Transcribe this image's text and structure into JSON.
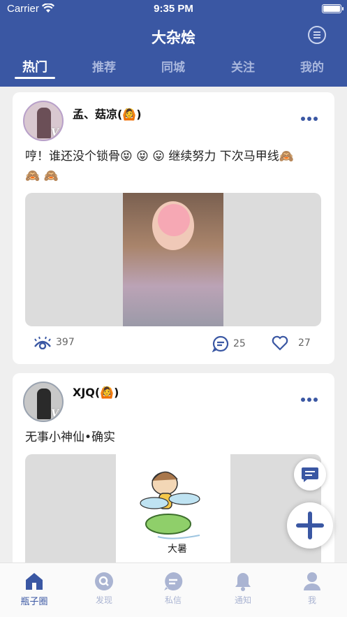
{
  "status": {
    "carrier": "Carrier",
    "time": "9:35 PM"
  },
  "header": {
    "title": "大杂烩"
  },
  "tabs": [
    "热门",
    "推荐",
    "同城",
    "关注",
    "我的"
  ],
  "posts": [
    {
      "name": "孟、菇凉(🙆)",
      "text_line1": "哼！谁还没个锁骨😝 😝 😛   继续努力 下次马甲线🙈",
      "text_line2": "🙈 🙈",
      "views": "397",
      "comments": "25",
      "likes": "27"
    },
    {
      "name": "XJQ(🙆)",
      "text_line1": "无事小神仙•确实"
    }
  ],
  "bottom_nav": [
    "瓶子圈",
    "发现",
    "私信",
    "通知",
    "我"
  ],
  "colors": {
    "primary": "#3a57a3",
    "inactive": "#aab4d2"
  }
}
